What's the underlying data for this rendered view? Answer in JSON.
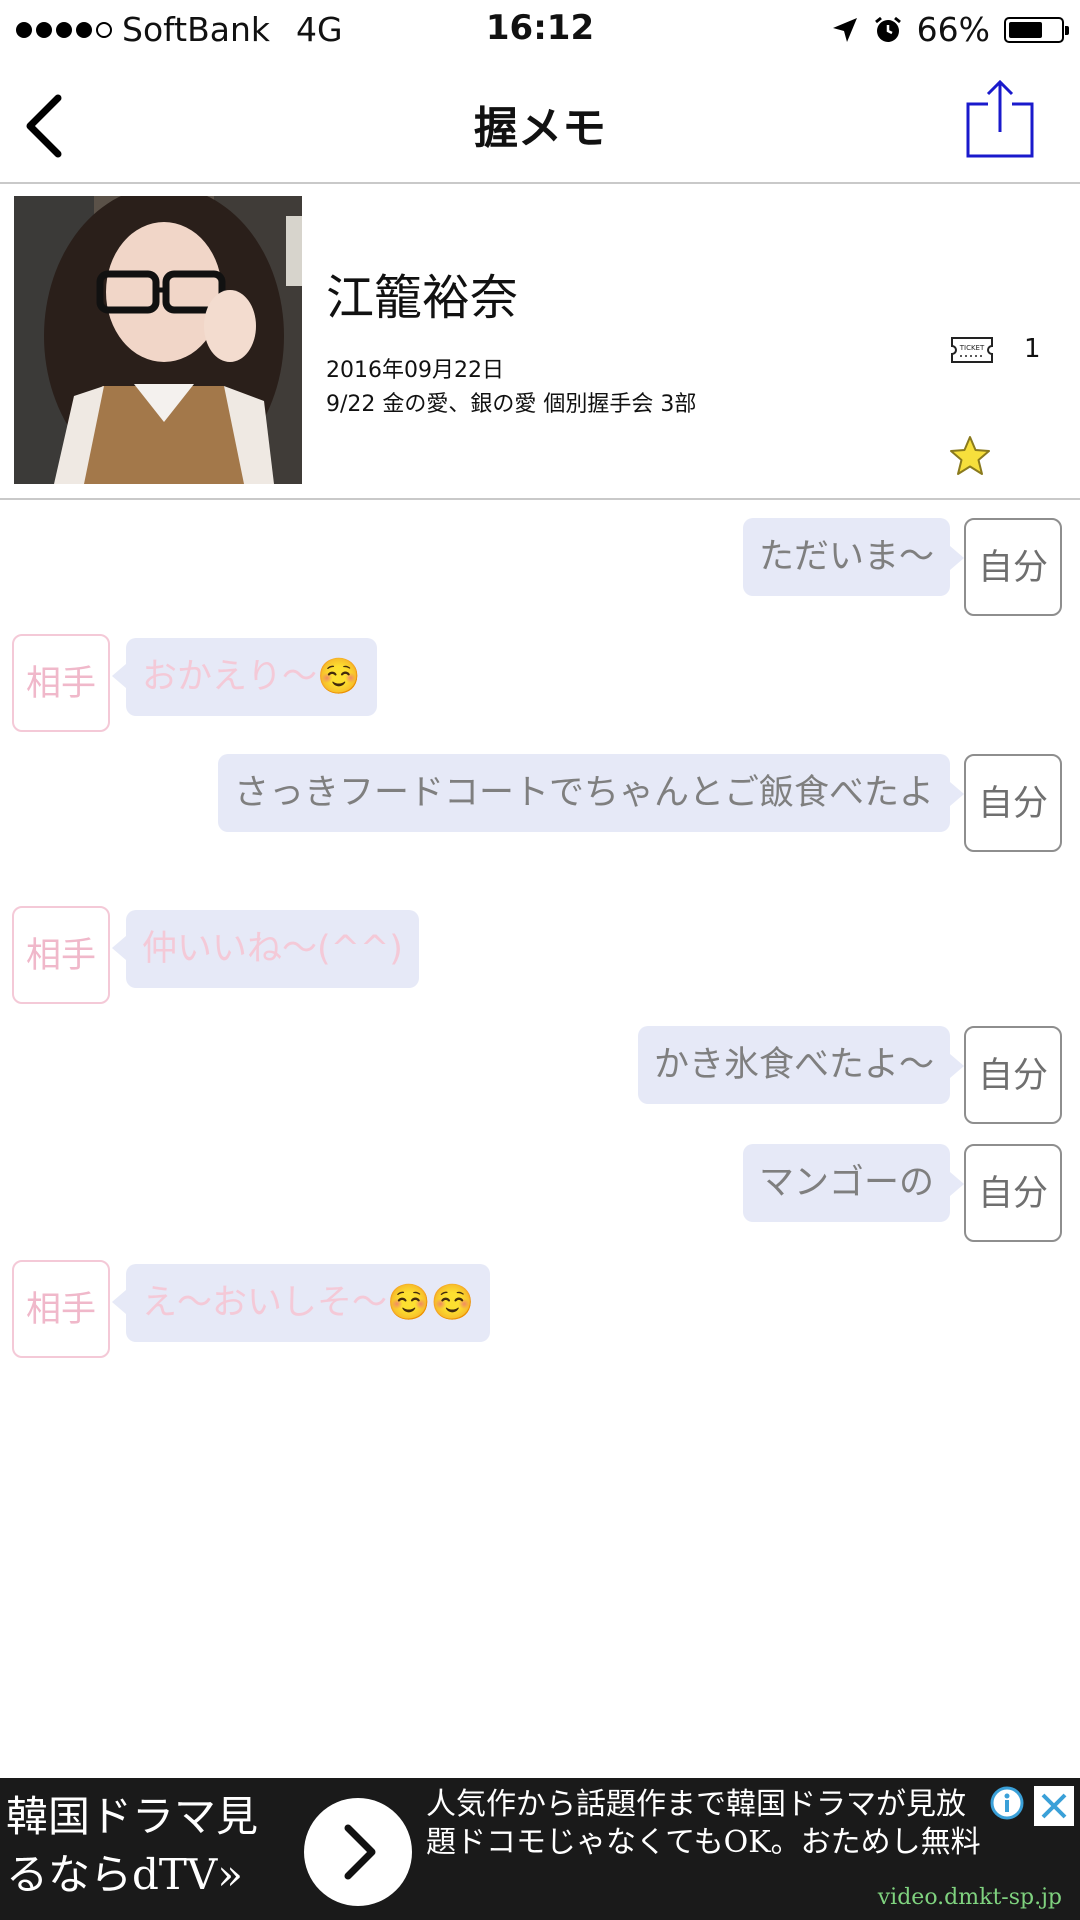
{
  "status_bar": {
    "carrier": "SoftBank",
    "network": "4G",
    "time": "16:12",
    "battery": "66%",
    "battery_level": 0.66,
    "signal_bars": 4
  },
  "nav": {
    "title": "握メモ",
    "back_icon": "chevron-left-icon",
    "share_icon": "share-icon"
  },
  "header": {
    "name": "江籠裕奈",
    "date": "2016年09月22日",
    "event": "9/22 金の愛、銀の愛 個別握手会 3部",
    "ticket_count": "1",
    "ticket_label": "TICKET",
    "favorite_icon": "star-icon"
  },
  "labels": {
    "self": "自分",
    "other": "相手"
  },
  "messages": [
    {
      "side": "self",
      "text": "ただいま〜"
    },
    {
      "side": "other",
      "text": "おかえり〜☺️"
    },
    {
      "side": "self",
      "text": "さっきフードコートでちゃんとご飯食べたよ"
    },
    {
      "side": "other",
      "text": "仲いいね〜(^^)"
    },
    {
      "side": "self",
      "text": "かき氷食べたよ〜"
    },
    {
      "side": "self",
      "text": "マンゴーの"
    },
    {
      "side": "other",
      "text": "え〜おいしそ〜☺️☺️"
    }
  ],
  "ad": {
    "left_line1": "韓国ドラマ見",
    "left_line2": "るならdTV»",
    "right_line1": "人気作から話題作まで韓国ドラマが見放",
    "right_line2": "題ドコモじゃなくてもOK。おためし無料",
    "url": "video.dmkt-sp.jp"
  },
  "colors": {
    "bubble_bg": "#e6e9f7",
    "self_text": "#7f7f7f",
    "other_text": "#f4c9d7",
    "share_icon": "#1a1acc",
    "ad_bg": "#1a1a1a",
    "ad_url": "#7fd27f"
  }
}
